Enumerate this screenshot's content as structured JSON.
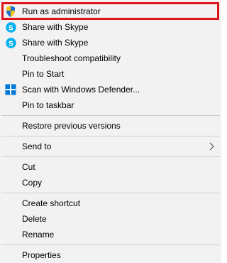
{
  "menu": {
    "items": [
      {
        "label": "Run as administrator",
        "icon": "uac-shield-icon"
      },
      {
        "label": "Share with Skype",
        "icon": "skype-icon"
      },
      {
        "label": "Share with Skype",
        "icon": "skype-icon"
      },
      {
        "label": "Troubleshoot compatibility",
        "icon": ""
      },
      {
        "label": "Pin to Start",
        "icon": ""
      },
      {
        "label": "Scan with Windows Defender...",
        "icon": "windows-defender-icon"
      },
      {
        "label": "Pin to taskbar",
        "icon": ""
      },
      {
        "label": "Restore previous versions",
        "icon": ""
      },
      {
        "label": "Send to",
        "icon": "",
        "submenu": true
      },
      {
        "label": "Cut",
        "icon": ""
      },
      {
        "label": "Copy",
        "icon": ""
      },
      {
        "label": "Create shortcut",
        "icon": ""
      },
      {
        "label": "Delete",
        "icon": ""
      },
      {
        "label": "Rename",
        "icon": ""
      },
      {
        "label": "Properties",
        "icon": ""
      }
    ],
    "highlight_color": "#e0151c",
    "skype_color": "#00aff0",
    "defender_color": "#0078d7"
  }
}
